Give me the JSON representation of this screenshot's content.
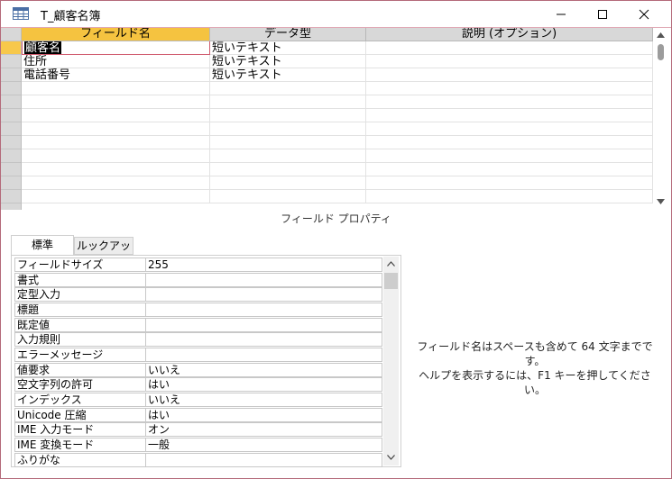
{
  "window": {
    "title": "T_顧客名簿",
    "icon": "table-icon",
    "controls": [
      "minimize-icon",
      "maximize-icon",
      "close-icon"
    ]
  },
  "grid": {
    "headers": {
      "field_name": "フィールド名",
      "data_type": "データ型",
      "description": "説明 (オプション)"
    },
    "rows": [
      {
        "field_name": "顧客名",
        "data_type": "短いテキスト",
        "description": ""
      },
      {
        "field_name": "住所",
        "data_type": "短いテキスト",
        "description": ""
      },
      {
        "field_name": "電話番号",
        "data_type": "短いテキスト",
        "description": ""
      }
    ]
  },
  "properties": {
    "section_label": "フィールド プロパティ",
    "tabs": {
      "general": "標準",
      "lookup": "ルックアップ"
    },
    "rows": [
      {
        "label": "フィールドサイズ",
        "value": "255"
      },
      {
        "label": "書式",
        "value": ""
      },
      {
        "label": "定型入力",
        "value": ""
      },
      {
        "label": "標題",
        "value": ""
      },
      {
        "label": "既定値",
        "value": ""
      },
      {
        "label": "入力規則",
        "value": ""
      },
      {
        "label": "エラーメッセージ",
        "value": ""
      },
      {
        "label": "値要求",
        "value": "いいえ"
      },
      {
        "label": "空文字列の許可",
        "value": "はい"
      },
      {
        "label": "インデックス",
        "value": "いいえ"
      },
      {
        "label": "Unicode 圧縮",
        "value": "はい"
      },
      {
        "label": "IME 入力モード",
        "value": "オン"
      },
      {
        "label": "IME 変換モード",
        "value": "一般"
      },
      {
        "label": "ふりがな",
        "value": ""
      }
    ]
  },
  "help": {
    "line1": "フィールド名はスペースも含めて 64 文字までです。",
    "line2": "ヘルプを表示するには、F1 キーを押してください。"
  },
  "colors": {
    "active_header": "#f5c340",
    "current_row_selector": "#f7c84b",
    "window_border": "#b46a7a"
  }
}
